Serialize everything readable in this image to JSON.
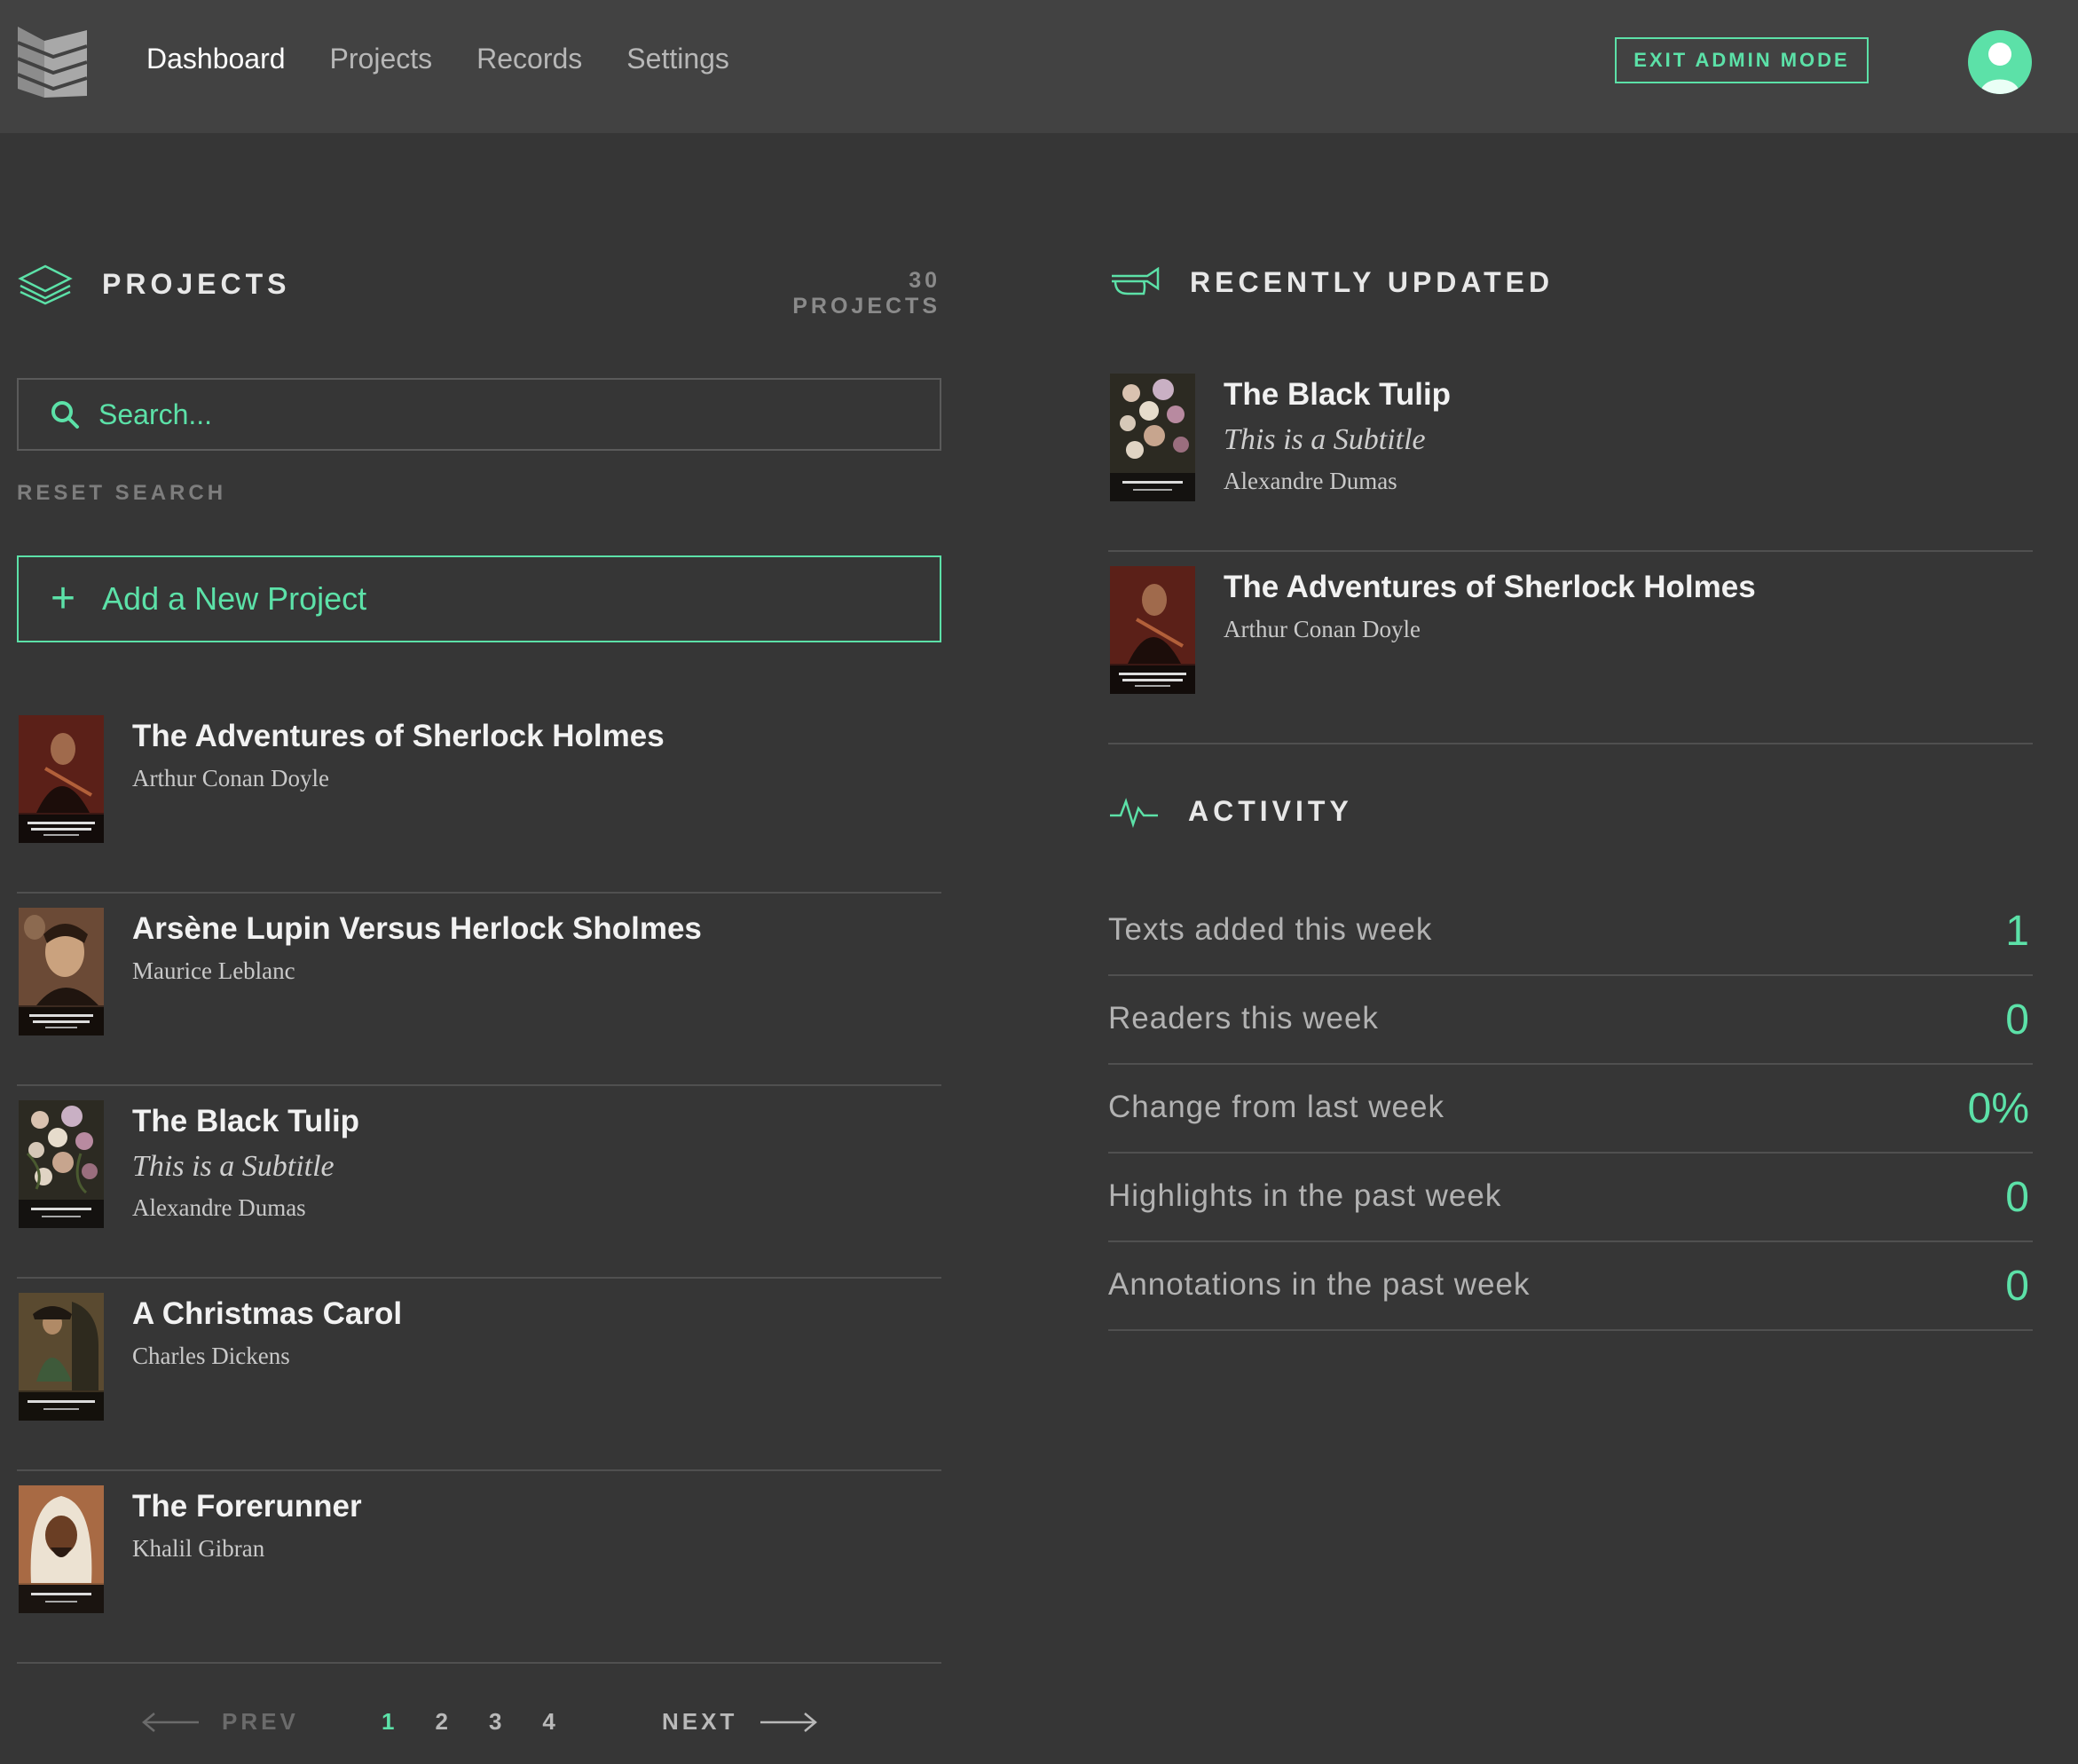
{
  "header": {
    "nav": [
      "Dashboard",
      "Projects",
      "Records",
      "Settings"
    ],
    "exit_label": "EXIT ADMIN MODE"
  },
  "projects_section": {
    "title": "PROJECTS",
    "count": "30 PROJECTS",
    "search_placeholder": "Search...",
    "reset_label": "RESET SEARCH",
    "add_label": "Add a New Project",
    "items": [
      {
        "title": "The Adventures of Sherlock Holmes",
        "subtitle": "",
        "author": "Arthur Conan Doyle"
      },
      {
        "title": "Arsène Lupin Versus Herlock Sholmes",
        "subtitle": "",
        "author": "Maurice Leblanc"
      },
      {
        "title": "The Black Tulip",
        "subtitle": "This is a Subtitle",
        "author": "Alexandre Dumas"
      },
      {
        "title": "A Christmas Carol",
        "subtitle": "",
        "author": "Charles Dickens"
      },
      {
        "title": "The Forerunner",
        "subtitle": "",
        "author": "Khalil Gibran"
      }
    ],
    "pagination": {
      "prev": "PREV",
      "next": "NEXT",
      "pages": [
        "1",
        "2",
        "3",
        "4"
      ],
      "current": "1"
    }
  },
  "recent_section": {
    "title": "RECENTLY UPDATED",
    "items": [
      {
        "title": "The Black Tulip",
        "subtitle": "This is a Subtitle",
        "author": "Alexandre Dumas"
      },
      {
        "title": "The Adventures of Sherlock Holmes",
        "subtitle": "",
        "author": "Arthur Conan Doyle"
      }
    ]
  },
  "activity_section": {
    "title": "ACTIVITY",
    "rows": [
      {
        "label": "Texts added this week",
        "value": "1"
      },
      {
        "label": "Readers this week",
        "value": "0"
      },
      {
        "label": "Change from last week",
        "value": "0%"
      },
      {
        "label": "Highlights in the past week",
        "value": "0"
      },
      {
        "label": "Annotations in the past week",
        "value": "0"
      }
    ]
  },
  "colors": {
    "accent": "#5ce1a8",
    "background": "#363636",
    "header": "#424242"
  }
}
